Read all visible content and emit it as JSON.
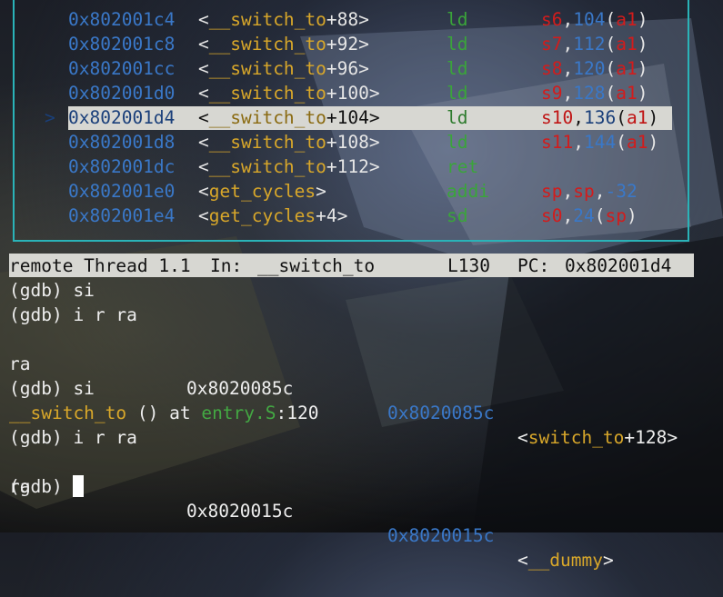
{
  "disasm": {
    "rows": [
      {
        "marker": "",
        "addr": "0x802001c4",
        "sym_open": "<",
        "sym": "__switch_to",
        "off": "+88>",
        "op": "ld",
        "reg": "s6",
        "n": "104",
        "base": "a1",
        "highlight": false
      },
      {
        "marker": "",
        "addr": "0x802001c8",
        "sym_open": "<",
        "sym": "__switch_to",
        "off": "+92>",
        "op": "ld",
        "reg": "s7",
        "n": "112",
        "base": "a1",
        "highlight": false
      },
      {
        "marker": "",
        "addr": "0x802001cc",
        "sym_open": "<",
        "sym": "__switch_to",
        "off": "+96>",
        "op": "ld",
        "reg": "s8",
        "n": "120",
        "base": "a1",
        "highlight": false
      },
      {
        "marker": "",
        "addr": "0x802001d0",
        "sym_open": "<",
        "sym": "__switch_to",
        "off": "+100>",
        "op": "ld",
        "reg": "s9",
        "n": "128",
        "base": "a1",
        "highlight": false
      },
      {
        "marker": ">",
        "addr": "0x802001d4",
        "sym_open": "<",
        "sym": "__switch_to",
        "off": "+104>",
        "op": "ld",
        "reg": "s10",
        "n": "136",
        "base": "a1",
        "highlight": true
      },
      {
        "marker": "",
        "addr": "0x802001d8",
        "sym_open": "<",
        "sym": "__switch_to",
        "off": "+108>",
        "op": "ld",
        "reg": "s11",
        "n": "144",
        "base": "a1",
        "highlight": false
      },
      {
        "marker": "",
        "addr": "0x802001dc",
        "sym_open": "<",
        "sym": "__switch_to",
        "off": "+112>",
        "op": "ret",
        "reg": "",
        "n": "",
        "base": "",
        "highlight": false
      },
      {
        "marker": "",
        "addr": "0x802001e0",
        "sym_open": "<",
        "sym": "get_cycles",
        "off": ">",
        "op": "addi",
        "args": "sp,sp,-32",
        "highlight": false
      },
      {
        "marker": "",
        "addr": "0x802001e4",
        "sym_open": "<",
        "sym": "get_cycles",
        "off": "+4>",
        "op": "sd",
        "reg": "s0",
        "n": "24",
        "base": "sp",
        "highlight": false
      }
    ]
  },
  "status": {
    "mode": "remote Thread 1.1",
    "in_label": "In:",
    "func": "__switch_to",
    "line": "L130",
    "pc_label": "PC:",
    "pc": "0x802001d4"
  },
  "console": {
    "l1": "(gdb) si",
    "l2": "(gdb) i r ra",
    "l3_reg": "ra",
    "l3_hex": "0x8020085c",
    "l3_addr": "0x8020085c",
    "l3_sym_open": "<",
    "l3_sym": "switch_to",
    "l3_sym_off": "+128>",
    "l4": "(gdb) si",
    "l5_func": "__switch_to",
    "l5_mid": " () at ",
    "l5_file": "entry.S",
    "l5_line": ":120",
    "l6": "(gdb) i r ra",
    "l7_reg": "ra",
    "l7_hex": "0x8020015c",
    "l7_addr": "0x8020015c",
    "l7_sym_open": "<",
    "l7_sym": "__dummy",
    "l7_sym_close": ">",
    "prompt": "(gdb)"
  },
  "colors": {
    "address": "#3a78c8",
    "symbol": "#d8a72a",
    "opcode": "#3aa53a",
    "register": "#d21c1c",
    "border": "#2ab3b8",
    "highlight_bg": "#d7d7d2"
  }
}
